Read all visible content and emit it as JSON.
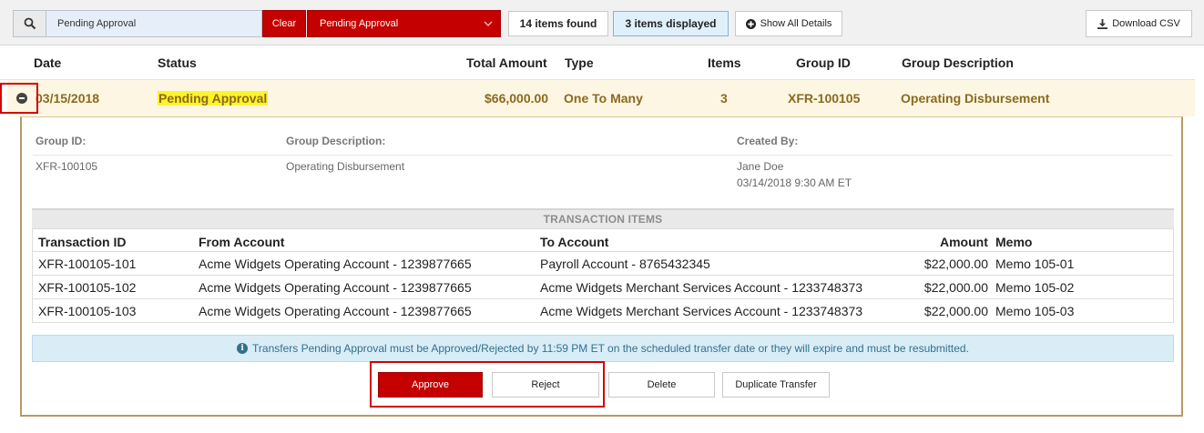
{
  "toolbar": {
    "search_value": "Pending Approval",
    "clear_label": "Clear",
    "status_filter": "Pending Approval",
    "items_found": "14 items found",
    "items_displayed": "3 items displayed",
    "show_all_label": "Show All Details",
    "download_label": "Download CSV"
  },
  "columns": {
    "date": "Date",
    "status": "Status",
    "total_amount": "Total Amount",
    "type": "Type",
    "items": "Items",
    "group_id": "Group ID",
    "group_description": "Group Description"
  },
  "row": {
    "date": "03/15/2018",
    "status": "Pending Approval",
    "total_amount": "$66,000.00",
    "type": "One To Many",
    "items": "3",
    "group_id": "XFR-100105",
    "group_description": "Operating Disbursement"
  },
  "detail": {
    "group_id_label": "Group ID:",
    "group_id_value": "XFR-100105",
    "group_desc_label": "Group Description:",
    "group_desc_value": "Operating Disbursement",
    "created_by_label": "Created By:",
    "created_by_name": "Jane Doe",
    "created_by_time": "03/14/2018 9:30 AM ET"
  },
  "transactions": {
    "title": "TRANSACTION ITEMS",
    "headers": {
      "id": "Transaction ID",
      "from": "From Account",
      "to": "To Account",
      "amount": "Amount",
      "memo": "Memo"
    },
    "rows": [
      {
        "id": "XFR-100105-101",
        "from": "Acme Widgets Operating Account - 1239877665",
        "to": "Payroll Account - 8765432345",
        "amount": "$22,000.00",
        "memo": "Memo 105-01"
      },
      {
        "id": "XFR-100105-102",
        "from": "Acme Widgets Operating Account - 1239877665",
        "to": "Acme Widgets Merchant Services Account - 1233748373",
        "amount": "$22,000.00",
        "memo": "Memo 105-02"
      },
      {
        "id": "XFR-100105-103",
        "from": "Acme Widgets Operating Account - 1239877665",
        "to": "Acme Widgets Merchant Services Account - 1233748373",
        "amount": "$22,000.00",
        "memo": "Memo 105-03"
      }
    ]
  },
  "notice": "Transfers Pending Approval must be Approved/Rejected by 11:59 PM ET on the scheduled transfer date or they will expire and must be resubmitted.",
  "actions": {
    "approve": "Approve",
    "reject": "Reject",
    "delete": "Delete",
    "duplicate": "Duplicate Transfer"
  },
  "colors": {
    "accent_red": "#c40000",
    "highlight_yellow": "#fff32a",
    "row_bg": "#fdf6e3",
    "info_bg": "#d9edf7",
    "annotation_red": "#d40000"
  },
  "icons": {
    "search": "search-icon",
    "dropdown": "chevron-down-icon",
    "show_all": "plus-circle-icon",
    "download": "download-icon",
    "collapse": "minus-circle-icon",
    "info": "info-icon"
  }
}
